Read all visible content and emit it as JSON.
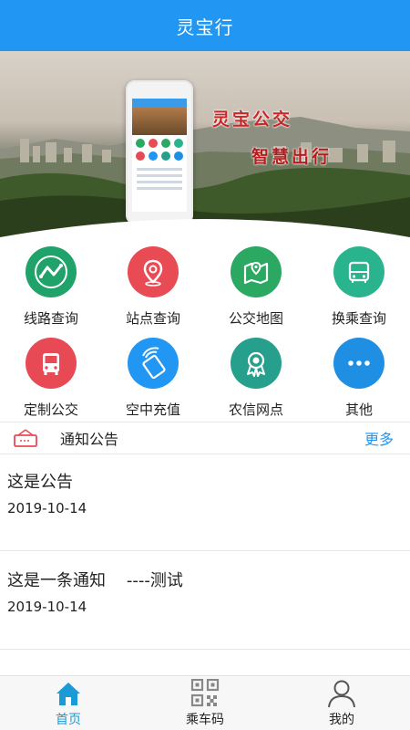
{
  "header": {
    "title": "灵宝行"
  },
  "banner": {
    "slogan_line1": "灵宝公交",
    "slogan_line2": "智慧出行"
  },
  "menu": [
    {
      "label": "线路查询",
      "icon": "route-icon",
      "color": "#20a36a"
    },
    {
      "label": "站点查询",
      "icon": "location-pin-icon",
      "color": "#e94b55"
    },
    {
      "label": "公交地图",
      "icon": "map-icon",
      "color": "#2ba862"
    },
    {
      "label": "换乘查询",
      "icon": "bus-transfer-icon",
      "color": "#2ab48e"
    },
    {
      "label": "定制公交",
      "icon": "bus-icon",
      "color": "#e84a55"
    },
    {
      "label": "空中充值",
      "icon": "nfc-card-icon",
      "color": "#2196f3"
    },
    {
      "label": "农信网点",
      "icon": "bank-badge-icon",
      "color": "#26a08d"
    },
    {
      "label": "其他",
      "icon": "more-dots-icon",
      "color": "#1e8fe3"
    }
  ],
  "notices": {
    "title": "通知公告",
    "more": "更多",
    "items": [
      {
        "title": "这是公告",
        "date": "2019-10-14"
      },
      {
        "title": "这是一条通知    ----测试",
        "date": "2019-10-14"
      }
    ]
  },
  "tabbar": {
    "items": [
      {
        "label": "首页",
        "icon": "home-icon",
        "active": true
      },
      {
        "label": "乘车码",
        "icon": "qr-code-icon",
        "active": false
      },
      {
        "label": "我的",
        "icon": "user-icon",
        "active": false
      }
    ],
    "active_color": "#1a9bd7"
  }
}
